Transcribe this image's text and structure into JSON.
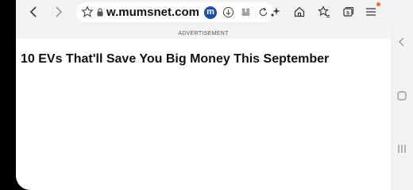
{
  "browser": {
    "url_text": "w.mumsnet.com",
    "site_badge": "m",
    "icons": {
      "back": "chevron-left-icon",
      "forward": "chevron-right-icon",
      "bookmark": "star-outline-icon",
      "lock": "lock-icon",
      "download": "download-icon",
      "reader": "reader-mode-icon",
      "reload": "reload-icon",
      "extensions": "sparkle-icon",
      "home": "home-icon",
      "bookmarks": "star-list-icon",
      "tabs": "tabs-icon",
      "menu": "menu-icon"
    },
    "tab_count": "5"
  },
  "page": {
    "ad_label": "ADVERTISEMENT",
    "headline": "10 EVs That'll Save You Big Money This September"
  },
  "system_nav": {
    "icons": [
      "back-nav-icon",
      "home-nav-icon",
      "recents-nav-icon"
    ]
  },
  "colors": {
    "toolbar_bg": "#f2f2f4",
    "badge": "#1e4fa6",
    "notification_dot": "#f07020"
  }
}
